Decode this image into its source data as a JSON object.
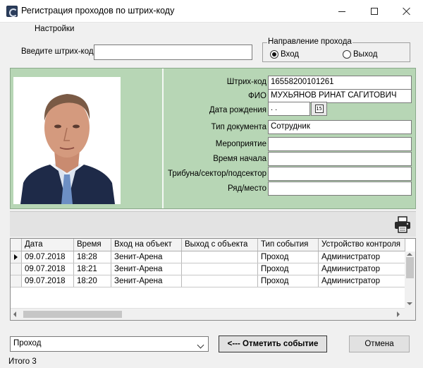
{
  "window": {
    "title": "Регистрация проходов по штрих-коду",
    "icon": "app-icon",
    "controls": {
      "minimize": "minimize-icon",
      "maximize": "maximize-icon",
      "close": "close-icon"
    }
  },
  "menu": {
    "items": [
      "Настройки"
    ]
  },
  "scan": {
    "label": "Введите штрих-код",
    "value": ""
  },
  "direction": {
    "legend": "Направление прохода",
    "options": [
      {
        "label": "Вход",
        "checked": true
      },
      {
        "label": "Выход",
        "checked": false
      }
    ]
  },
  "person": {
    "panel_color": "#b7d6b5",
    "photo": "person-photo",
    "fields": [
      {
        "label": "Штрих-код",
        "value": "16558200101261"
      },
      {
        "label": "ФИО",
        "value": "МУХЬЯНОВ РИНАТ САГИТОВИЧ"
      },
      {
        "label": "Дата рождения",
        "value": " .  ."
      },
      {
        "label": "Тип документа",
        "value": "Сотрудник"
      },
      {
        "label": "Мероприятие",
        "value": ""
      },
      {
        "label": "Время начала",
        "value": ""
      },
      {
        "label": "Трибуна/сектор/подсектор",
        "value": ""
      },
      {
        "label": "Ряд/место",
        "value": ""
      }
    ],
    "calendar_icon": "calendar-icon",
    "calendar_icon_text": "15"
  },
  "toolbar": {
    "print_icon": "printer-icon"
  },
  "grid": {
    "columns": [
      "Дата",
      "Время",
      "Вход на объект",
      "Выход с объекта",
      "Тип события",
      "Устройство контроля"
    ],
    "rows": [
      [
        "09.07.2018",
        "18:28",
        "Зенит-Арена",
        "",
        "Проход",
        "Администратор"
      ],
      [
        "09.07.2018",
        "18:21",
        "Зенит-Арена",
        "",
        "Проход",
        "Администратор"
      ],
      [
        "09.07.2018",
        "18:20",
        "Зенит-Арена",
        "",
        "Проход",
        "Администратор"
      ]
    ],
    "current_row": 0
  },
  "footer": {
    "event_type": "Проход",
    "mark_button": "<--- Отметить событие",
    "cancel_button": "Отмена",
    "total": "Итого 3"
  }
}
